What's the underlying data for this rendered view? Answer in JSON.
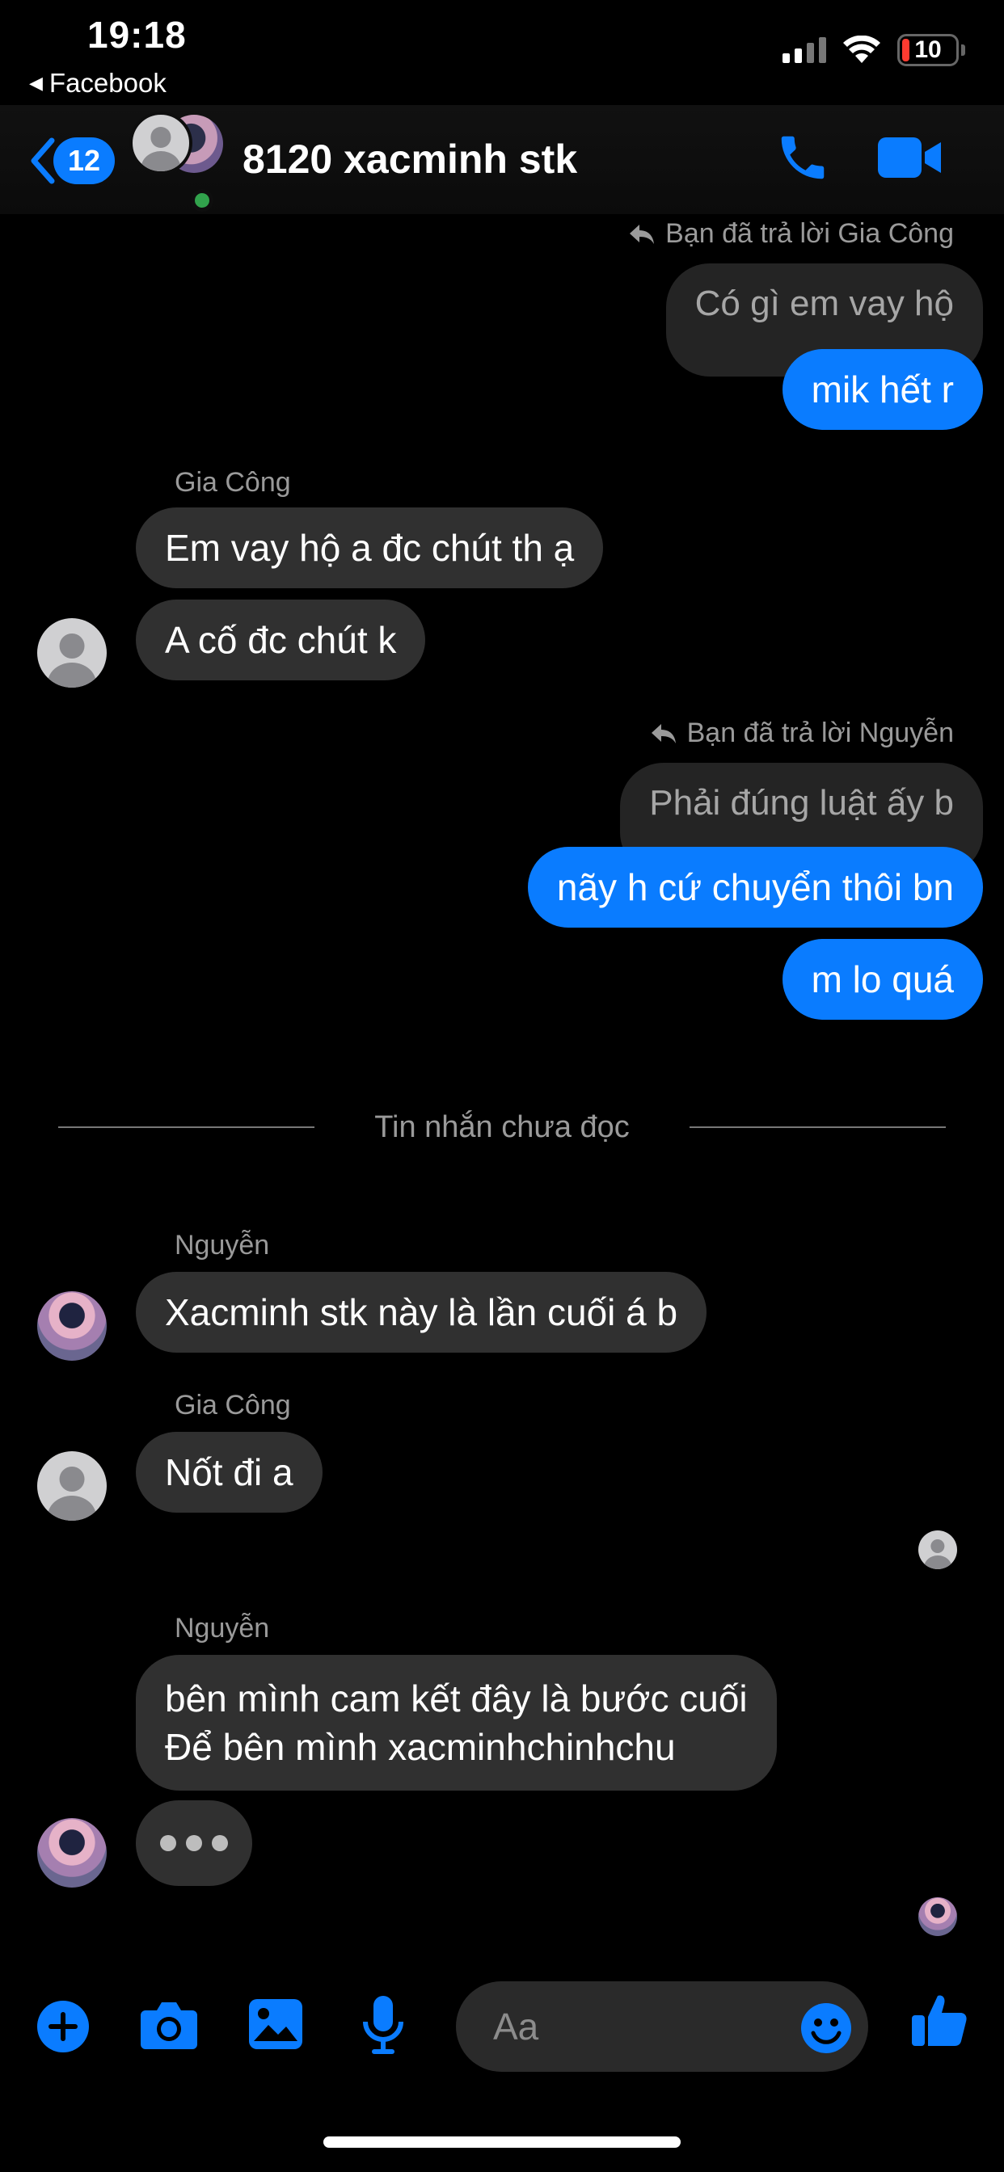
{
  "status_bar": {
    "time": "19:18",
    "back_app": "Facebook",
    "battery": "10"
  },
  "header": {
    "unread_count": "12",
    "title": "8120 xacminh stk"
  },
  "messages": {
    "reply_note_1": "Bạn đã trả lời Gia Công",
    "quote_1": "Có gì em vay hộ",
    "me_1": "mik hết r",
    "sender_1": "Gia Công",
    "them_1a": "Em vay hộ a đc chút th ạ",
    "them_1b": "A cố đc chút k",
    "reply_note_2": "Bạn đã trả lời Nguyễn",
    "quote_2": "Phải đúng luật ấy b",
    "me_2a": "nãy h cứ chuyển thôi bn",
    "me_2b": "m lo quá",
    "divider": "Tin nhắn chưa đọc",
    "sender_2": "Nguyễn",
    "them_2": "Xacminh stk này là lần cuối á b",
    "sender_3": "Gia Công",
    "them_3": "Nốt đi a",
    "sender_4": "Nguyễn",
    "them_4_line1": "bên mình cam kết đây là bước cuối",
    "them_4_line2": "Để bên mình xacminhchinhchu"
  },
  "composer": {
    "placeholder": "Aa"
  },
  "colors": {
    "accent": "#0a7cff",
    "bubble_in": "#303030",
    "background": "#000000",
    "online": "#31a24c"
  },
  "icons": [
    "back-chevron-icon",
    "phone-icon",
    "video-camera-icon",
    "plus-icon",
    "camera-icon",
    "image-icon",
    "microphone-icon",
    "emoji-icon",
    "thumbs-up-icon",
    "reply-arrow-icon",
    "wifi-icon",
    "signal-icon",
    "battery-icon"
  ]
}
